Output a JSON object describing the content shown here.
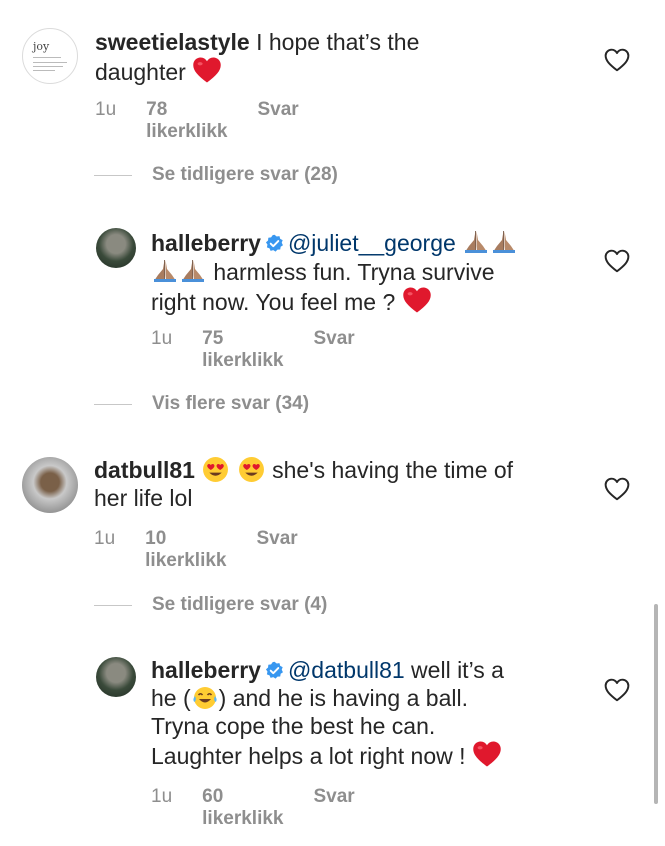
{
  "comments": [
    {
      "username": "sweetielastyle",
      "text_line1": " I hope that’s the",
      "text_line2": "daughter ",
      "time": "1u",
      "likes": "78 likerklikk",
      "reply": "Svar",
      "avatar_word": "joy"
    },
    {
      "username": "halleberry",
      "mention": "@juliet__george",
      "text_line2": " harmless fun. Tryna survive",
      "text_line3": "right now.  You feel me ? ",
      "time": "1u",
      "likes": "75 likerklikk",
      "reply": "Svar"
    },
    {
      "username": "datbull81",
      "text_line1": " she's having the time of",
      "text_line2": "her life lol",
      "time": "1u",
      "likes": "10 likerklikk",
      "reply": "Svar"
    },
    {
      "username": "halleberry",
      "mention": "@datbull81",
      "text_line1": " well it’s a",
      "text_line2a": "he (",
      "text_line2b": ") and he is having a ball.",
      "text_line3": "Tryna cope the best he can.",
      "text_line4": "Laughter helps a lot right now ! ",
      "time": "1u",
      "likes": "60 likerklikk",
      "reply": "Svar"
    }
  ],
  "thread_toggles": [
    "Se tidligere svar (28)",
    "Vis flere svar (34)",
    "Se tidligere svar (4)"
  ],
  "icons": {
    "like": "heart-outline-icon",
    "verified": "verified-badge-icon",
    "red_heart": "red-heart-emoji",
    "praying_hands": "folded-hands-emoji",
    "heart_eyes": "heart-eyes-emoji",
    "tears_of_joy": "tears-of-joy-emoji"
  },
  "colors": {
    "text": "#262626",
    "secondary": "#8e8e8e",
    "verified": "#3897f0",
    "mention": "#00376b",
    "heart": "#e0182d"
  }
}
